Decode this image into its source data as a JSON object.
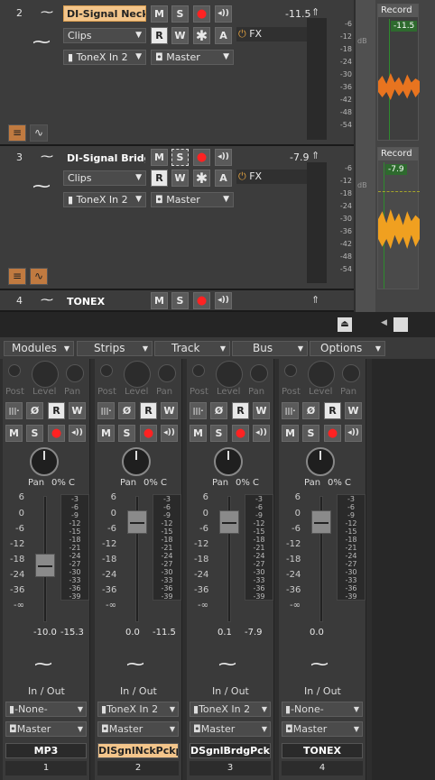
{
  "tracks": [
    {
      "number": "2",
      "name": "DI-Signal Neck P",
      "selected": true,
      "volume": "-11.5",
      "input_mode": "Clips",
      "input": "ToneX In 2",
      "output": "Master",
      "fx": "FX",
      "record_label": "Record",
      "peak": "-11.5"
    },
    {
      "number": "3",
      "name": "DI-Signal Bridge",
      "selected": false,
      "volume": "-7.9",
      "input_mode": "Clips",
      "input": "ToneX In 2",
      "output": "Master",
      "fx": "FX",
      "record_label": "Record",
      "peak": "-7.9"
    },
    {
      "number": "4",
      "name": "TONEX",
      "selected": false
    }
  ],
  "buttons": {
    "mute": "M",
    "solo": "S",
    "read": "R",
    "write": "W",
    "automation": "A",
    "star": "✱",
    "add": "+"
  },
  "meter_scale": [
    "-6",
    "-12",
    "-18",
    "-24",
    "-30",
    "-36",
    "-42",
    "-48",
    "-54"
  ],
  "meter_unit": "dB",
  "console_menu": [
    "Modules",
    "Strips",
    "Track",
    "Bus",
    "Options"
  ],
  "strip_labels": {
    "post": "Post",
    "level": "Level",
    "pan": "Pan",
    "io": "In / Out"
  },
  "strips": [
    {
      "name": "MP3",
      "number": "1",
      "pan_value": "0% C",
      "fader": "-10.0",
      "peak": "-15.3",
      "input": "-None-",
      "output": "Master",
      "selected": false
    },
    {
      "name": "DISgnlNckPckpTo",
      "number": "2",
      "pan_value": "0% C",
      "fader": "0.0",
      "peak": "-11.5",
      "input": "ToneX In 2",
      "output": "Master",
      "selected": true
    },
    {
      "name": "DSgnlBrdgPckpT",
      "number": "3",
      "pan_value": "0% C",
      "fader": "0.1",
      "peak": "-7.9",
      "input": "ToneX In 2",
      "output": "Master",
      "selected": false
    },
    {
      "name": "TONEX",
      "number": "4",
      "pan_value": "0% C",
      "fader": "0.0",
      "peak": "",
      "input": "-None-",
      "output": "Master",
      "selected": false
    }
  ],
  "fader_scale": [
    "6",
    "0",
    "-6",
    "-12",
    "-18",
    "-24",
    "-36",
    "-∞"
  ],
  "strip_meter_scale": [
    "-3",
    "-6",
    "-9",
    "-12",
    "-15",
    "-18",
    "-21",
    "-24",
    "-27",
    "-30",
    "-33",
    "-36",
    "-39"
  ],
  "colors": {
    "selected": "#f3c58b",
    "record": "#ff2222",
    "clip_wave": "#e8741f",
    "peak_badge": "#2e6a2e"
  }
}
